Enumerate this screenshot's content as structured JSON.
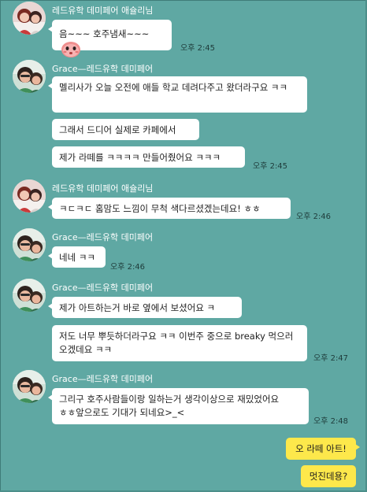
{
  "colors": {
    "background": "#5fa8a3",
    "bubble_other": "#ffffff",
    "bubble_mine": "#fde84b",
    "sender_name": "#ffffff"
  },
  "messages": [
    {
      "sender": "레드유학 데미페어 애슐리님",
      "avatar": "avatar-photo-ashley",
      "bubbles": [
        {
          "text": "음~~~ 호주냄새~~~",
          "emoji": "blushing-face-emoji",
          "time": "오후 2:45"
        }
      ]
    },
    {
      "sender": "Grace—레드유학 데미페어",
      "avatar": "avatar-photo-grace",
      "bubbles": [
        {
          "text": "멜리사가 오늘 오전에 애들 학교 데려다주고 왔더라구요 ㅋㅋ",
          "time": ""
        },
        {
          "text": "그래서 드디어 실제로 카페에서",
          "time": ""
        },
        {
          "text": "제가 라떼를 ㅋㅋㅋㅋ 만들어줬어요 ㅋㅋㅋ",
          "time": "오후 2:45"
        }
      ]
    },
    {
      "sender": "레드유학 데미페어 애슐리님",
      "avatar": "avatar-photo-ashley",
      "bubbles": [
        {
          "text": "ㅋㄷㅋㄷ 홈맘도 느낌이 무척 색다르셨겠는데요! ㅎㅎ",
          "time": "오후 2:46"
        }
      ]
    },
    {
      "sender": "Grace—레드유학 데미페어",
      "avatar": "avatar-photo-grace",
      "bubbles": [
        {
          "text": "네네 ㅋㅋ",
          "time": "오후 2:46"
        }
      ]
    },
    {
      "sender": "Grace—레드유학 데미페어",
      "avatar": "avatar-photo-grace",
      "bubbles": [
        {
          "text": "제가 아트하는거 바로 옆에서 보셨어요 ㅋ",
          "time": ""
        },
        {
          "text": "저도 너무 뿌듯하더라구요 ㅋㅋ 이번주 중으로 breaky 먹으러 오겠데요 ㅋㅋ",
          "time": "오후 2:47"
        }
      ]
    },
    {
      "sender": "Grace—레드유학 데미페어",
      "avatar": "avatar-photo-grace",
      "bubbles": [
        {
          "text": "그리구 호주사람들이랑 일하는거 생각이상으로 재밌었어요 ㅎㅎ앞으로도 기대가 되네요>_<",
          "time": "오후 2:48"
        }
      ]
    }
  ],
  "my_messages": [
    {
      "text": "오 라떼 아트!"
    },
    {
      "text": "멋진데용?"
    }
  ]
}
